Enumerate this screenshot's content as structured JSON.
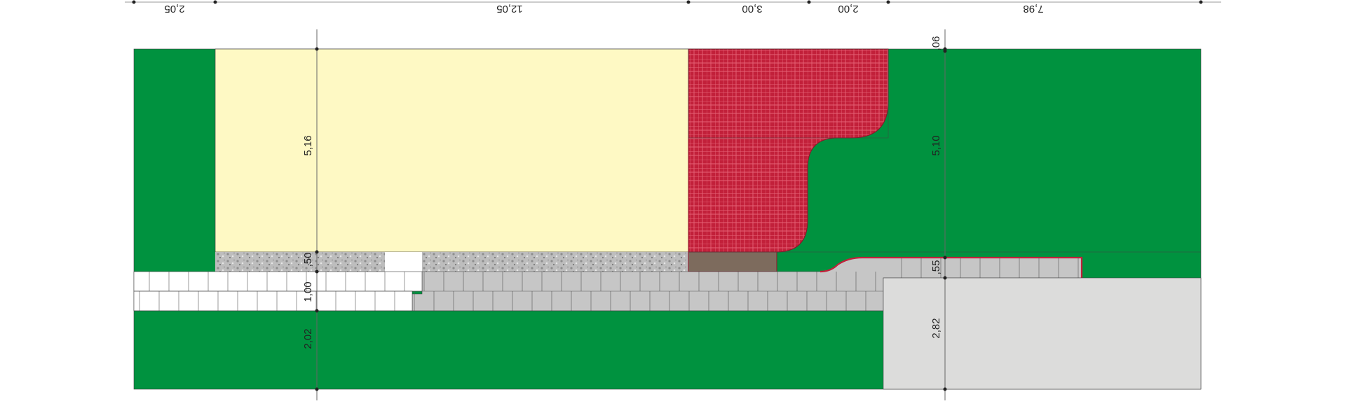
{
  "colors": {
    "lawn": "#00923f",
    "building": "#fef9c4",
    "red_paving": "#c2203a",
    "red_grid": "#e56276",
    "gravel": "#bdbdbd",
    "light_gray_paving": "#dcdcdb",
    "mid_gray_paving": "#c6c6c6",
    "white_paving": "#ffffff",
    "brown_step": "#7d6b5d",
    "line": "#444444"
  },
  "top_dimensions": {
    "a": "2,05",
    "b": "12,05",
    "c": "3,00",
    "d": "2,00",
    "e": "7,98"
  },
  "left_dimensions": {
    "a": "5,16",
    "b": ",50",
    "c": "1,00",
    "d": "2,02"
  },
  "right_dimensions": {
    "a": ",06",
    "b": "5,10",
    "c": ",55",
    "d": "2,82"
  }
}
